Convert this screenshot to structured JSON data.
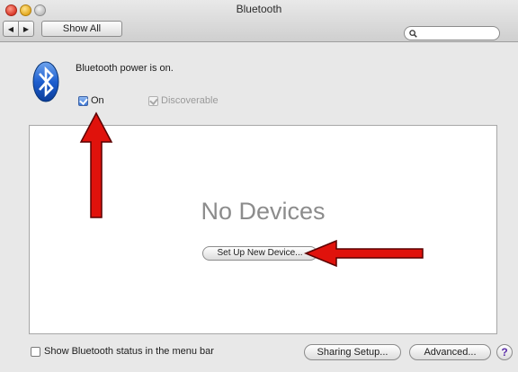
{
  "window": {
    "title": "Bluetooth"
  },
  "toolbar": {
    "back_glyph": "◀",
    "forward_glyph": "▶",
    "show_all_label": "Show All",
    "search_placeholder": "",
    "search_icon": "magnifier-icon"
  },
  "bluetooth": {
    "icon": "bluetooth-icon",
    "power_status": "Bluetooth power is on.",
    "on_label": "On",
    "on_checked": true,
    "discoverable_label": "Discoverable",
    "discoverable_checked": true,
    "discoverable_enabled": false
  },
  "devices": {
    "empty_text": "No Devices",
    "setup_button_label": "Set Up New Device..."
  },
  "footer": {
    "status_label": "Show Bluetooth status in the menu bar",
    "status_checked": false,
    "sharing_button_label": "Sharing Setup...",
    "advanced_button_label": "Advanced...",
    "help_label": "?"
  },
  "annotations": {
    "arrow_color": "#e0120c",
    "arrows": [
      "arrow-pointing-up-to-on-checkbox",
      "arrow-pointing-left-to-setup-button"
    ]
  }
}
